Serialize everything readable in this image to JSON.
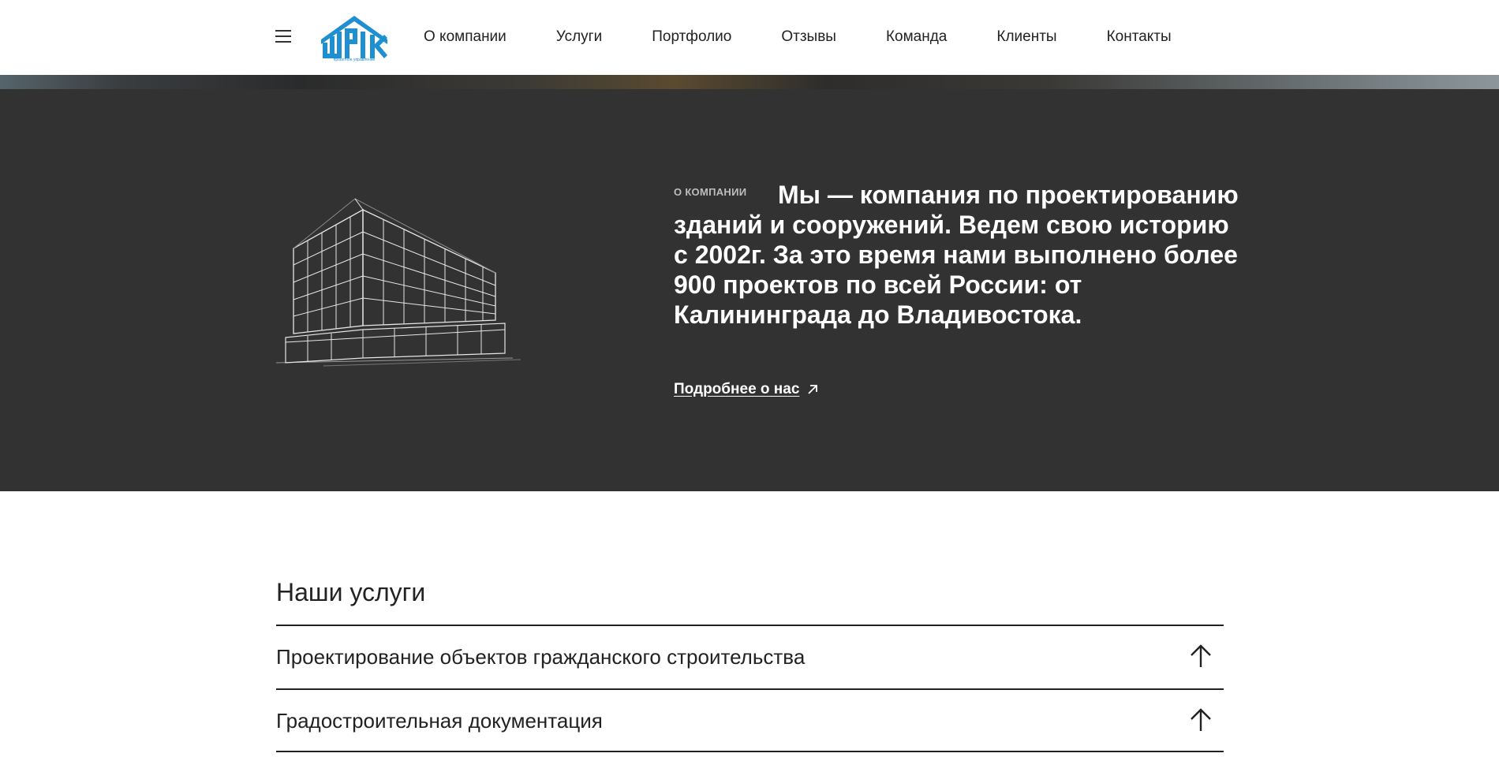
{
  "header": {
    "logo_alt": "ШТРИХ проектное управление",
    "nav": [
      {
        "label": "О компании"
      },
      {
        "label": "Услуги"
      },
      {
        "label": "Портфолио"
      },
      {
        "label": "Отзывы"
      },
      {
        "label": "Команда"
      },
      {
        "label": "Клиенты"
      },
      {
        "label": "Контакты"
      }
    ]
  },
  "about": {
    "label": "О компании",
    "text": "Мы — компания по проектированию зданий и сооружений. Ведем свою историю с 2002г. За это время нами выполнено более 900 проектов по всей России: от Калининграда до Владивостока.",
    "link_label": "Подробнее о нас"
  },
  "services": {
    "title": "Наши услуги",
    "items": [
      {
        "label": "Проектирование объектов гражданского строительства"
      },
      {
        "label": "Градостроительная документация"
      }
    ]
  },
  "colors": {
    "logo_blue": "#1e8fd0",
    "dark_bg": "#323232"
  }
}
